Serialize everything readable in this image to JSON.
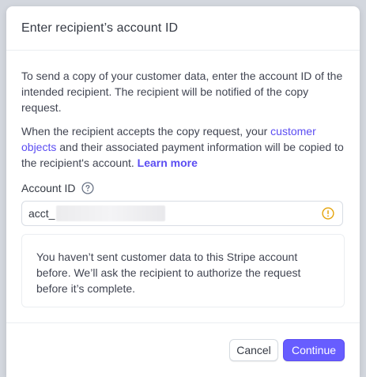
{
  "modal": {
    "title": "Enter recipient’s account ID",
    "intro": "To send a copy of your customer data, enter the account ID of the intended recipient. The recipient will be notified of the copy request.",
    "accept_pre": "When the recipient accepts the copy request, your ",
    "customer_objects_link": "customer objects",
    "accept_post": " and their associated payment information will be copied to the recipient's account. ",
    "learn_more_link": "Learn more",
    "field_label": "Account ID",
    "field_value": "acct_",
    "notice": "You haven’t sent customer data to this Stripe account before. We’ll ask the recipient to authorize the request before it’s complete.",
    "cancel_label": "Cancel",
    "continue_label": "Continue"
  },
  "colors": {
    "accent": "#675dff",
    "link": "#5b4df2",
    "warning": "#e5a40b"
  },
  "icons": {
    "help": "question-circle-icon",
    "warning": "exclamation-circle-icon"
  }
}
